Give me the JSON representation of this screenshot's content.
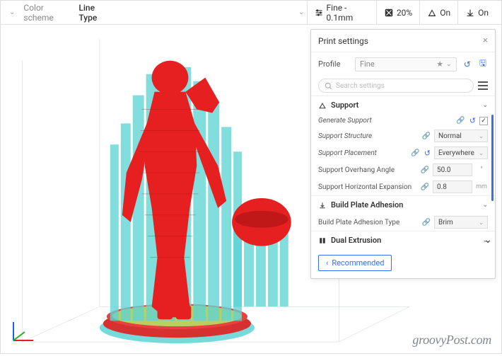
{
  "toolbar": {
    "color_scheme_label": "Color scheme",
    "line_type_label": "Line Type",
    "quality_label": "Fine - 0.1mm",
    "infill_label": "20%",
    "on_label_1": "On",
    "on_label_2": "On"
  },
  "panel": {
    "title": "Print settings",
    "profile_label": "Profile",
    "profile_value": "Fine",
    "search_placeholder": "Search settings"
  },
  "sections": {
    "support": {
      "title": "Support",
      "generate_label": "Generate Support",
      "generate_checked": true,
      "structure_label": "Support Structure",
      "structure_value": "Normal",
      "placement_label": "Support Placement",
      "placement_value": "Everywhere",
      "overhang_label": "Support Overhang Angle",
      "overhang_value": "50.0",
      "horiz_label": "Support Horizontal Expansion",
      "horiz_value": "0.8",
      "horiz_unit": "mm"
    },
    "adhesion": {
      "title": "Build Plate Adhesion",
      "type_label": "Build Plate Adhesion Type",
      "type_value": "Brim"
    },
    "dual": {
      "title": "Dual Extrusion"
    }
  },
  "recommended_label": "Recommended",
  "watermark": "groovyPost.com"
}
